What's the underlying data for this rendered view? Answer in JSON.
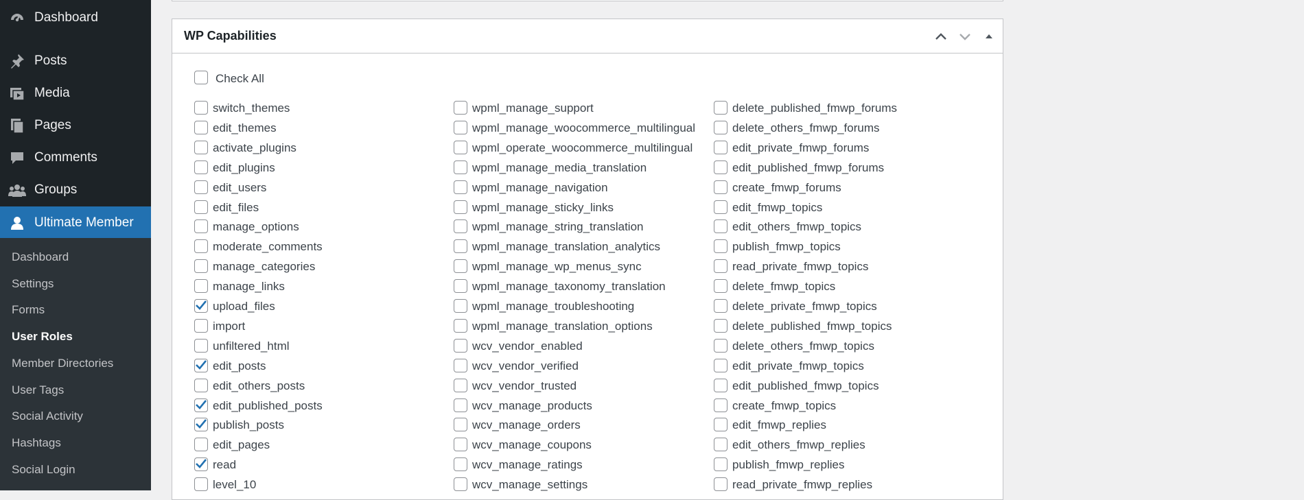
{
  "sidebar": {
    "items": [
      {
        "label": "Dashboard",
        "icon": "dashboard-icon"
      },
      {
        "label": "Posts",
        "icon": "pushpin-icon"
      },
      {
        "label": "Media",
        "icon": "media-icon"
      },
      {
        "label": "Pages",
        "icon": "pages-icon"
      },
      {
        "label": "Comments",
        "icon": "comment-bubble-icon"
      },
      {
        "label": "Groups",
        "icon": "groups-icon"
      },
      {
        "label": "Ultimate Member",
        "icon": "user-icon",
        "active": true
      }
    ],
    "submenu": [
      {
        "label": "Dashboard"
      },
      {
        "label": "Settings"
      },
      {
        "label": "Forms"
      },
      {
        "label": "User Roles",
        "current": true
      },
      {
        "label": "Member Directories"
      },
      {
        "label": "User Tags"
      },
      {
        "label": "Social Activity"
      },
      {
        "label": "Hashtags"
      },
      {
        "label": "Social Login"
      }
    ]
  },
  "metabox": {
    "title": "WP Capabilities",
    "check_all_label": "Check All",
    "columns": [
      [
        {
          "name": "switch_themes",
          "checked": false
        },
        {
          "name": "edit_themes",
          "checked": false
        },
        {
          "name": "activate_plugins",
          "checked": false
        },
        {
          "name": "edit_plugins",
          "checked": false
        },
        {
          "name": "edit_users",
          "checked": false
        },
        {
          "name": "edit_files",
          "checked": false
        },
        {
          "name": "manage_options",
          "checked": false
        },
        {
          "name": "moderate_comments",
          "checked": false
        },
        {
          "name": "manage_categories",
          "checked": false
        },
        {
          "name": "manage_links",
          "checked": false
        },
        {
          "name": "upload_files",
          "checked": true
        },
        {
          "name": "import",
          "checked": false
        },
        {
          "name": "unfiltered_html",
          "checked": false
        },
        {
          "name": "edit_posts",
          "checked": true
        },
        {
          "name": "edit_others_posts",
          "checked": false
        },
        {
          "name": "edit_published_posts",
          "checked": true
        },
        {
          "name": "publish_posts",
          "checked": true
        },
        {
          "name": "edit_pages",
          "checked": false
        },
        {
          "name": "read",
          "checked": true
        },
        {
          "name": "level_10",
          "checked": false
        }
      ],
      [
        {
          "name": "wpml_manage_support",
          "checked": false
        },
        {
          "name": "wpml_manage_woocommerce_multilingual",
          "checked": false
        },
        {
          "name": "wpml_operate_woocommerce_multilingual",
          "checked": false
        },
        {
          "name": "wpml_manage_media_translation",
          "checked": false
        },
        {
          "name": "wpml_manage_navigation",
          "checked": false
        },
        {
          "name": "wpml_manage_sticky_links",
          "checked": false
        },
        {
          "name": "wpml_manage_string_translation",
          "checked": false
        },
        {
          "name": "wpml_manage_translation_analytics",
          "checked": false
        },
        {
          "name": "wpml_manage_wp_menus_sync",
          "checked": false
        },
        {
          "name": "wpml_manage_taxonomy_translation",
          "checked": false
        },
        {
          "name": "wpml_manage_troubleshooting",
          "checked": false
        },
        {
          "name": "wpml_manage_translation_options",
          "checked": false
        },
        {
          "name": "wcv_vendor_enabled",
          "checked": false
        },
        {
          "name": "wcv_vendor_verified",
          "checked": false
        },
        {
          "name": "wcv_vendor_trusted",
          "checked": false
        },
        {
          "name": "wcv_manage_products",
          "checked": false
        },
        {
          "name": "wcv_manage_orders",
          "checked": false
        },
        {
          "name": "wcv_manage_coupons",
          "checked": false
        },
        {
          "name": "wcv_manage_ratings",
          "checked": false
        },
        {
          "name": "wcv_manage_settings",
          "checked": false
        }
      ],
      [
        {
          "name": "delete_published_fmwp_forums",
          "checked": false
        },
        {
          "name": "delete_others_fmwp_forums",
          "checked": false
        },
        {
          "name": "edit_private_fmwp_forums",
          "checked": false
        },
        {
          "name": "edit_published_fmwp_forums",
          "checked": false
        },
        {
          "name": "create_fmwp_forums",
          "checked": false
        },
        {
          "name": "edit_fmwp_topics",
          "checked": false
        },
        {
          "name": "edit_others_fmwp_topics",
          "checked": false
        },
        {
          "name": "publish_fmwp_topics",
          "checked": false
        },
        {
          "name": "read_private_fmwp_topics",
          "checked": false
        },
        {
          "name": "delete_fmwp_topics",
          "checked": false
        },
        {
          "name": "delete_private_fmwp_topics",
          "checked": false
        },
        {
          "name": "delete_published_fmwp_topics",
          "checked": false
        },
        {
          "name": "delete_others_fmwp_topics",
          "checked": false
        },
        {
          "name": "edit_private_fmwp_topics",
          "checked": false
        },
        {
          "name": "edit_published_fmwp_topics",
          "checked": false
        },
        {
          "name": "create_fmwp_topics",
          "checked": false
        },
        {
          "name": "edit_fmwp_replies",
          "checked": false
        },
        {
          "name": "edit_others_fmwp_replies",
          "checked": false
        },
        {
          "name": "publish_fmwp_replies",
          "checked": false
        },
        {
          "name": "read_private_fmwp_replies",
          "checked": false
        }
      ]
    ]
  },
  "colors": {
    "sidebar_bg": "#1d2327",
    "submenu_bg": "#2c3338",
    "active_bg": "#2271b1",
    "checkmark": "#2271b1"
  }
}
